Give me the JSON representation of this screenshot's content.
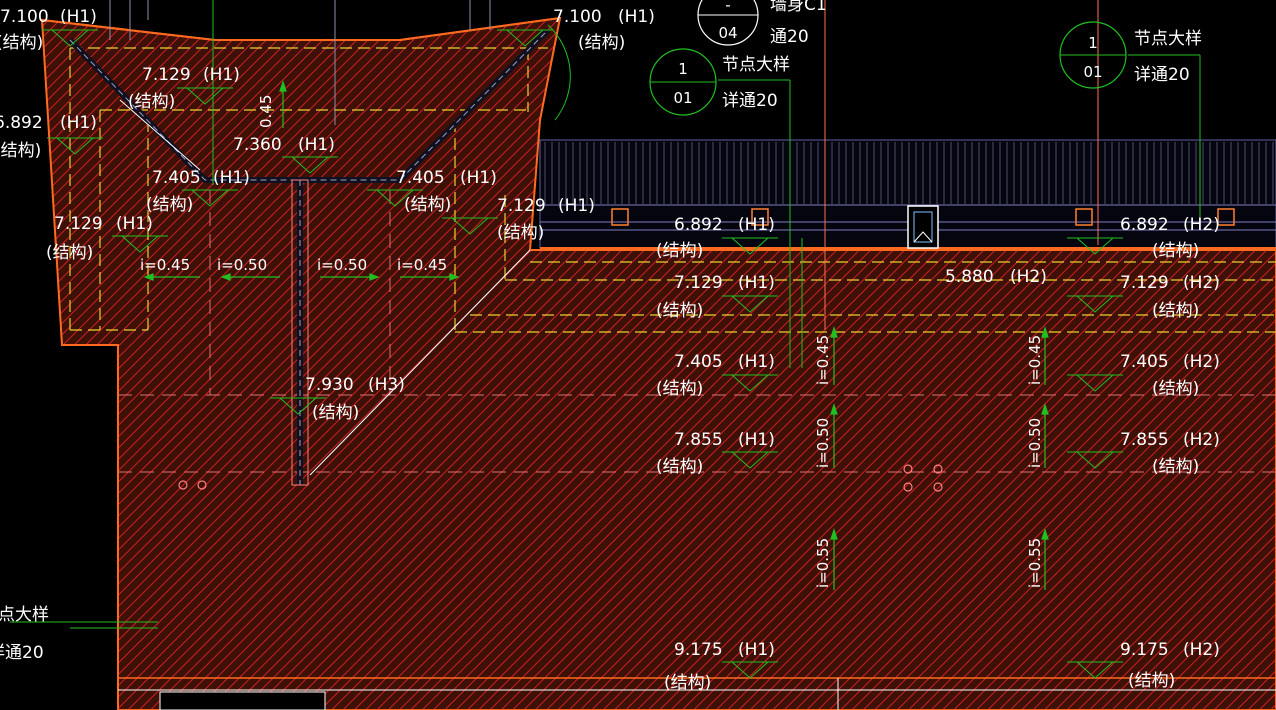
{
  "colors": {
    "background": "#000000",
    "hatch": "#c81e1e",
    "hatch_fill": "#4a1508",
    "outline": "#ff6a20",
    "dash_yellow": "#e8d030",
    "green": "#20c020",
    "white": "#ffffff",
    "pink": "#e08080",
    "grey": "#9090a8"
  },
  "annotations": {
    "struct": "(结构)",
    "h1": "(H1)",
    "h2": "(H2)",
    "h3": "(H3)"
  },
  "elevations": {
    "e7100": "7.100",
    "e7129": "7.129",
    "e6892": "6.892",
    "e7360": "7.360",
    "e7405": "7.405",
    "e7930": "7.930",
    "e5880": "5.880",
    "e7855": "7.855",
    "e9175": "9.175"
  },
  "slopes": {
    "s045": "i=0.45",
    "s050": "i=0.50",
    "s055": "i=0.55",
    "s045_alt": "0.45",
    "i_prefix": "i="
  },
  "detail_callouts": {
    "node_detail": "节点大样",
    "detail_ref": "详通20",
    "detail_ref_partial": "通20",
    "wall_partial": "墙身C1",
    "bubble_top_1": "1",
    "bubble_bottom_01": "01",
    "bubble_dash": "-",
    "bubble_04": "04",
    "node_partial": "点大样",
    "ref_partial": "详通20"
  }
}
